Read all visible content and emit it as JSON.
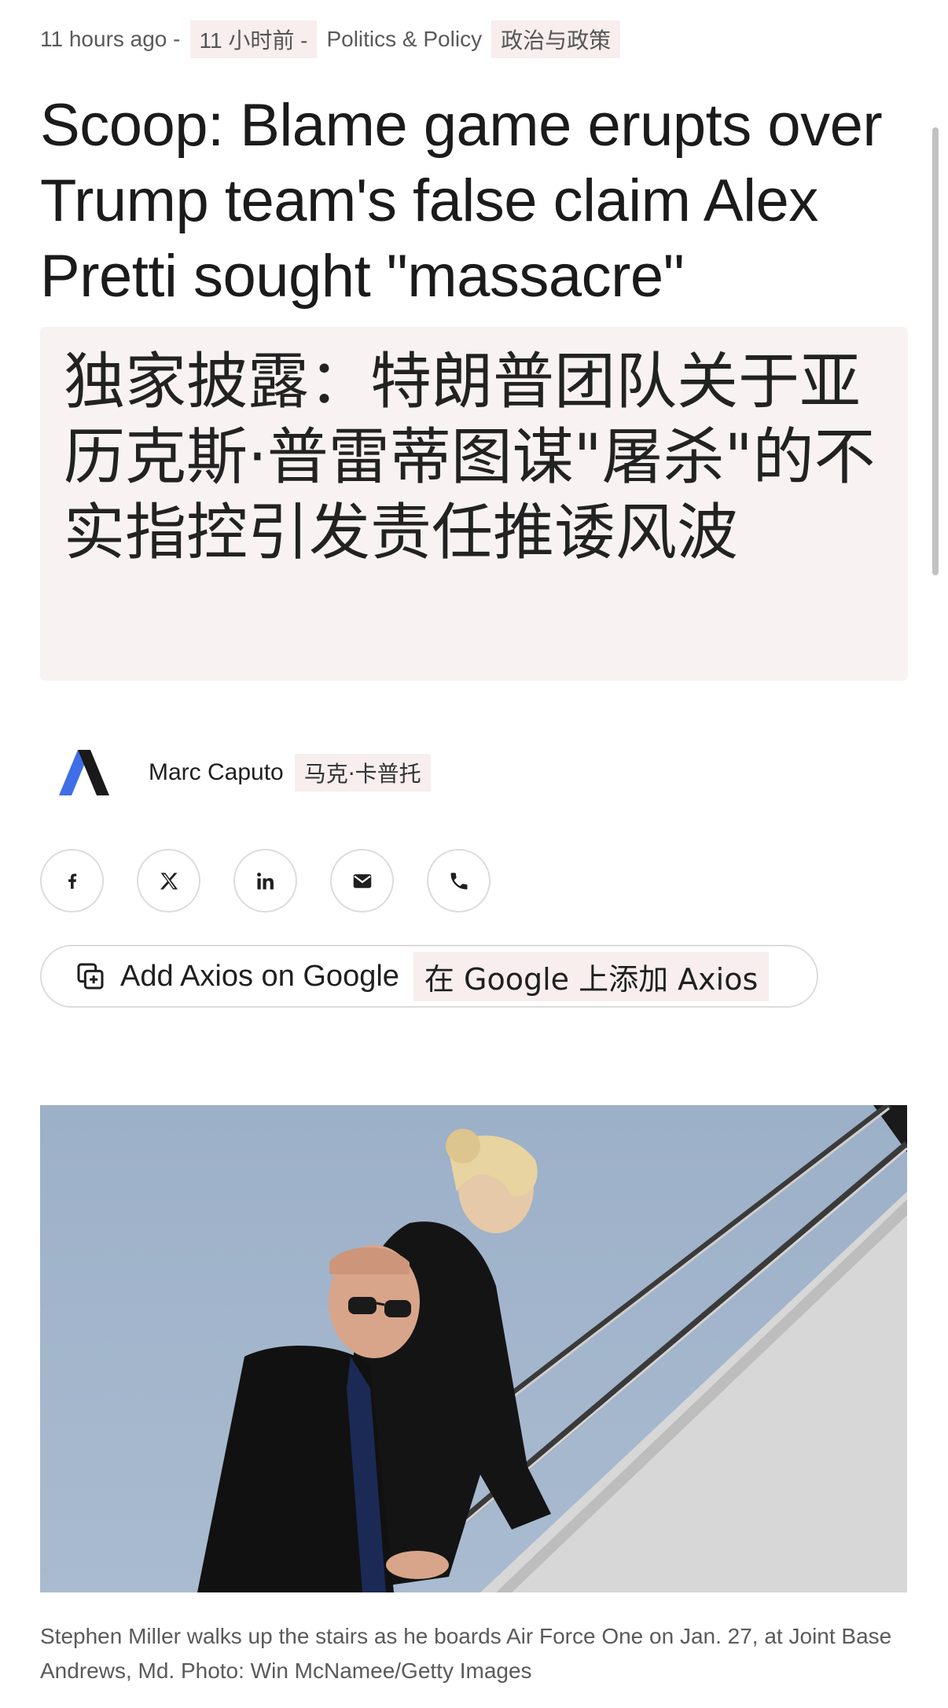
{
  "meta": {
    "time": "11 hours ago -",
    "time_tr": "11 小时前 -",
    "category": "Politics & Policy",
    "category_tr": "政治与政策"
  },
  "headline": "Scoop: Blame game erupts over Trump team's false claim Alex Pretti sought \"massacre\"",
  "headline_tr": "独家披露：特朗普团队关于亚历克斯·普雷蒂图谋\"屠杀\"的不实指控引发责任推诿风波",
  "author": {
    "name": "Marc Caputo",
    "name_tr": "马克·卡普托",
    "logo_icon": "axios-logo-icon"
  },
  "share": [
    {
      "icon": "facebook-icon"
    },
    {
      "icon": "x-icon"
    },
    {
      "icon": "linkedin-icon"
    },
    {
      "icon": "email-icon"
    },
    {
      "icon": "phone-icon"
    }
  ],
  "google_button": {
    "label": "Add Axios on Google",
    "label_tr": "在 Google 上添加 Axios",
    "icon": "add-to-collection-icon"
  },
  "photo": {
    "caption": "Stephen Miller walks up the stairs as he boards Air Force One on Jan. 27, at Joint Base Andrews, Md. Photo: Win McNamee/Getty Images"
  },
  "colors": {
    "translation_bg": "#f8eeee",
    "logo_blue": "#3f6ee6",
    "text": "#1f1f1f"
  }
}
